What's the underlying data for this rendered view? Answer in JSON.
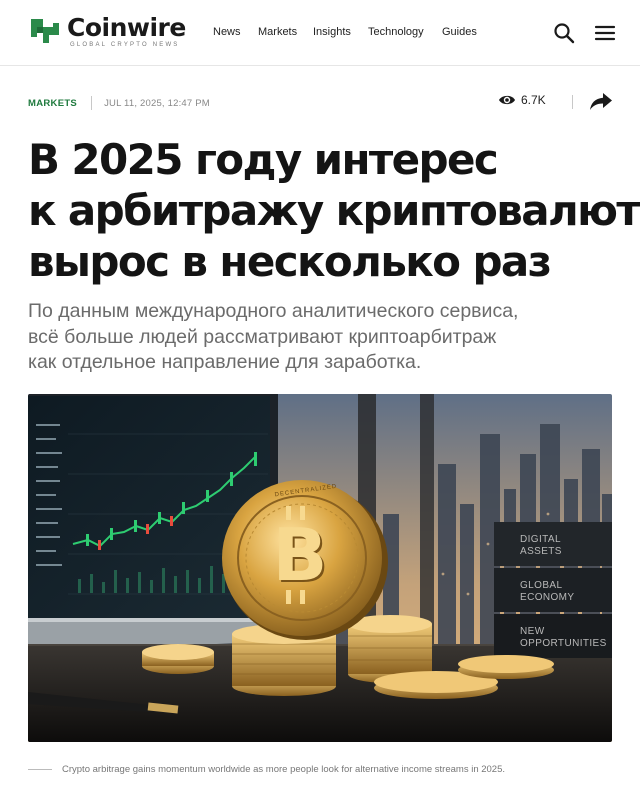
{
  "brand": {
    "name": "Coinwire",
    "tagline": "GLOBAL CRYPTO NEWS"
  },
  "nav": {
    "items": [
      "News",
      "Markets",
      "Insights",
      "Technology",
      "Guides"
    ]
  },
  "header_icons": {
    "search": "search-icon",
    "menu": "hamburger-menu-icon"
  },
  "article": {
    "category": "MARKETS",
    "datetime": "JUL 11, 2025, 12:47 PM",
    "views": "6.7K",
    "title_lines": [
      "В 2025 году интерес",
      "к арбитражу криптовалют",
      "вырос в несколько раз"
    ],
    "lead_lines": [
      "По данным международного аналитического сервиса,",
      "всё больше людей рассматривают криптоарбитраж",
      "как отдельное направление для заработка."
    ],
    "image_labels": [
      "DIGITAL ASSETS",
      "GLOBAL ECONOMY",
      "NEW OPPORTUNITIES"
    ],
    "coin_text": "DECENTRALIZED",
    "caption": "Crypto arbitrage gains momentum worldwide as more people look for alternative income streams in 2025."
  },
  "colors": {
    "accent": "#1f7a3e",
    "gold": "#d9a441",
    "text": "#141414",
    "muted": "#6b6b6b"
  }
}
